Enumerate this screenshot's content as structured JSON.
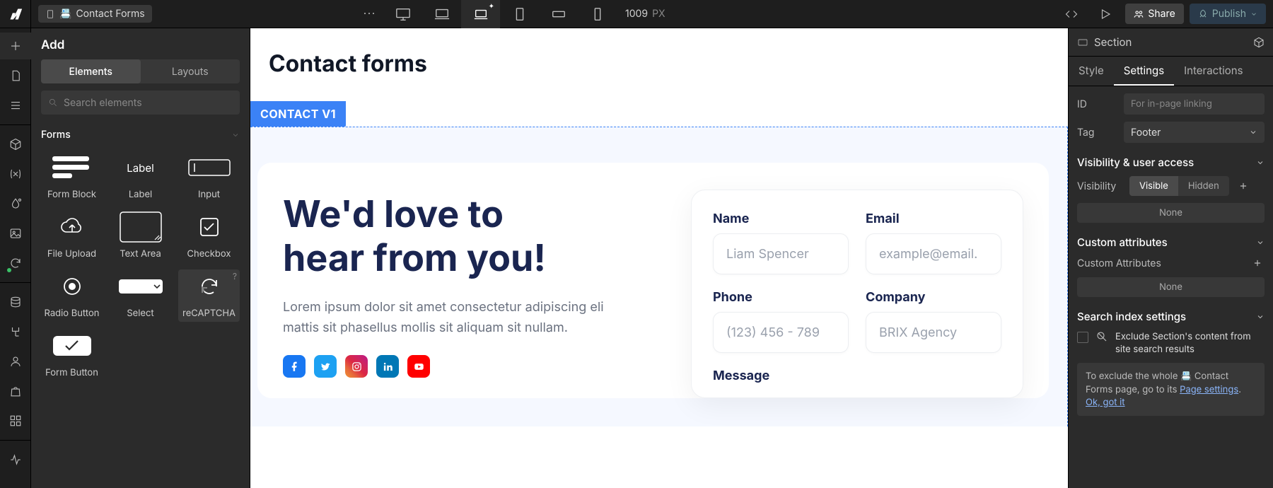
{
  "topbar": {
    "breadcrumb_icon": "📇",
    "breadcrumb_label": "Contact Forms",
    "viewport_size": "1009",
    "viewport_unit": "PX",
    "share_label": "Share",
    "publish_label": "Publish"
  },
  "add_panel": {
    "title": "Add",
    "tabs": {
      "elements": "Elements",
      "layouts": "Layouts"
    },
    "search_placeholder": "Search elements",
    "section": "Forms",
    "items": {
      "form_block": "Form Block",
      "label": "Label",
      "input": "Input",
      "file_upload": "File Upload",
      "text_area": "Text Area",
      "checkbox": "Checkbox",
      "radio": "Radio Button",
      "select": "Select",
      "recaptcha": "reCAPTCHA",
      "form_button": "Form Button"
    },
    "label_thumb_text": "Label"
  },
  "canvas": {
    "page_title": "Contact forms",
    "section_label": "CONTACT V1",
    "hero_line1": "We'd love to",
    "hero_line2": "hear from you!",
    "hero_body": "Lorem ipsum dolor sit amet consectetur adipiscing eli mattis sit phasellus mollis sit aliquam sit nullam.",
    "form": {
      "name_label": "Name",
      "name_placeholder": "Liam Spencer",
      "email_label": "Email",
      "email_placeholder": "example@email.",
      "phone_label": "Phone",
      "phone_placeholder": "(123) 456 - 789",
      "company_label": "Company",
      "company_placeholder": "BRIX Agency",
      "message_label": "Message"
    }
  },
  "right_panel": {
    "element_type": "Section",
    "tabs": {
      "style": "Style",
      "settings": "Settings",
      "interactions": "Interactions"
    },
    "id_label": "ID",
    "id_placeholder": "For in-page linking",
    "tag_label": "Tag",
    "tag_value": "Footer",
    "visibility_section": "Visibility & user access",
    "visibility_label": "Visibility",
    "visible": "Visible",
    "hidden": "Hidden",
    "none": "None",
    "custom_attrs_section": "Custom attributes",
    "custom_attrs_label": "Custom Attributes",
    "search_index_section": "Search index settings",
    "exclude_text": "Exclude Section's content from site search results",
    "info_prefix": "To exclude the whole ",
    "info_icon": "📇",
    "info_mid": " Contact Forms page, go to its ",
    "info_link": "Page settings",
    "got_it": "Ok, got it"
  }
}
